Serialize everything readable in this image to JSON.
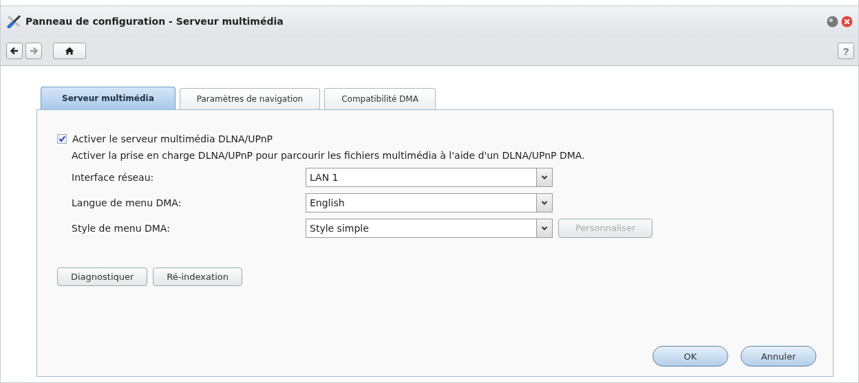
{
  "window": {
    "title": "Panneau de configuration - Serveur multimédia"
  },
  "toolbar": {
    "back": {
      "disabled": false
    },
    "forward": {
      "disabled": true
    },
    "help": "?"
  },
  "tabs": [
    {
      "label": "Serveur multimédia",
      "selected": true
    },
    {
      "label": "Paramètres de navigation",
      "selected": false
    },
    {
      "label": "Compatibilité DMA",
      "selected": false
    }
  ],
  "enable": {
    "label": "Activer le serveur multimédia DLNA/UPnP",
    "checked": true
  },
  "description": "Activer la prise en charge DLNA/UPnP pour parcourir les fichiers multimédia à l'aide d'un DLNA/UPnP DMA.",
  "fields": [
    {
      "label": "Interface réseau:",
      "value": "LAN 1"
    },
    {
      "label": "Langue de menu DMA:",
      "value": "English"
    },
    {
      "label": "Style de menu DMA:",
      "value": "Style simple",
      "button": {
        "label": "Personnaliser",
        "disabled": true
      }
    }
  ],
  "actions": [
    {
      "label": "Diagnostiquer",
      "disabled": false
    },
    {
      "label": "Ré-indexation",
      "disabled": false
    }
  ],
  "footer": [
    "OK",
    "Annuler"
  ]
}
